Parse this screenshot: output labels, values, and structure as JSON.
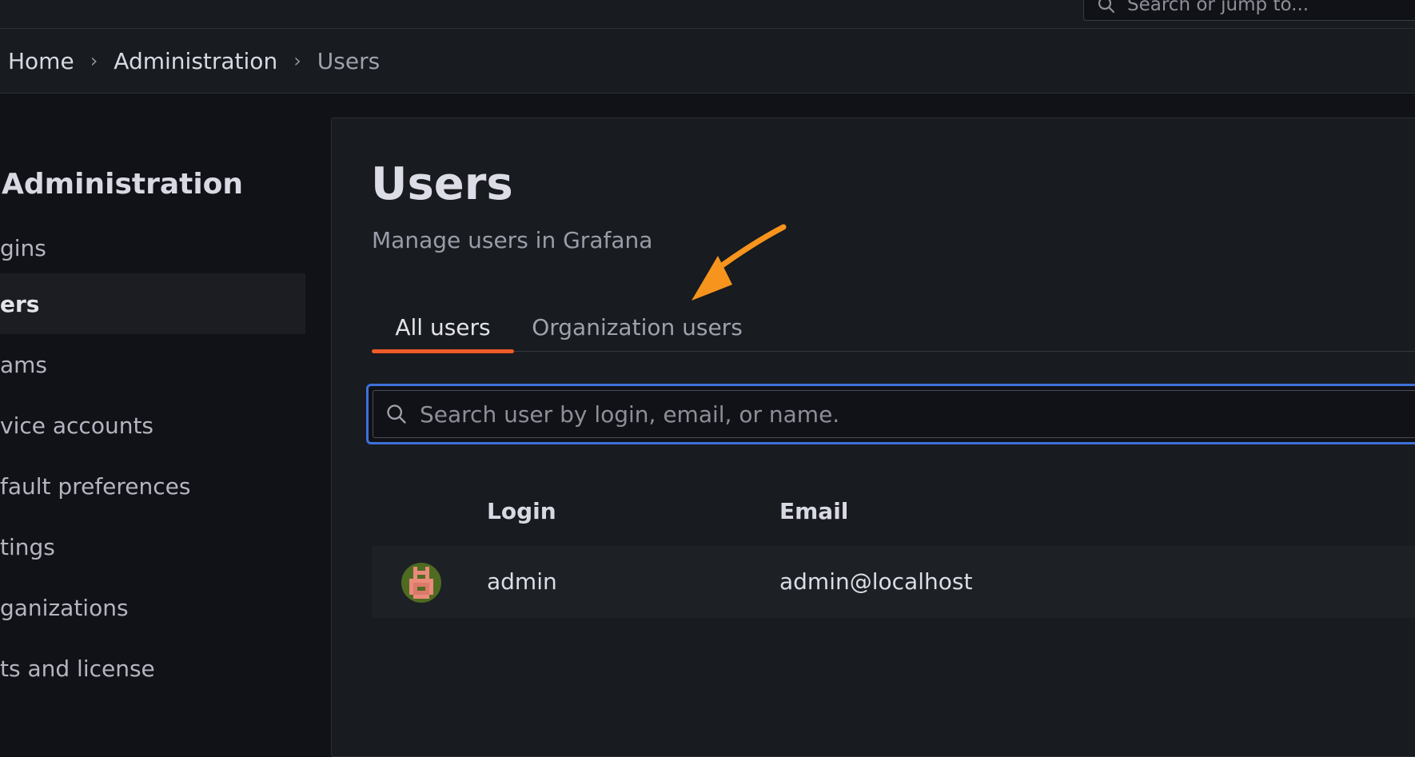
{
  "top_search": {
    "placeholder": "Search or jump to..."
  },
  "breadcrumb": [
    "Home",
    "Administration",
    "Users"
  ],
  "sidebar": {
    "title": "Administration",
    "items": [
      {
        "label": "gins",
        "active": false
      },
      {
        "label": "ers",
        "active": true
      },
      {
        "label": "ams",
        "active": false
      },
      {
        "label": "vice accounts",
        "active": false
      },
      {
        "label": "fault preferences",
        "active": false
      },
      {
        "label": "tings",
        "active": false
      },
      {
        "label": "ganizations",
        "active": false
      },
      {
        "label": "ts and license",
        "active": false
      }
    ]
  },
  "page": {
    "title": "Users",
    "subtitle": "Manage users in Grafana"
  },
  "tabs": [
    {
      "label": "All users",
      "active": true
    },
    {
      "label": "Organization users",
      "active": false
    }
  ],
  "search": {
    "placeholder": "Search user by login, email, or name."
  },
  "table": {
    "columns": [
      "Login",
      "Email"
    ],
    "rows": [
      {
        "login": "admin",
        "email": "admin@localhost"
      }
    ]
  },
  "colors": {
    "accent_tab": "#f05a28",
    "focus_border": "#3d71d9",
    "annotation_arrow": "#f7941d"
  }
}
